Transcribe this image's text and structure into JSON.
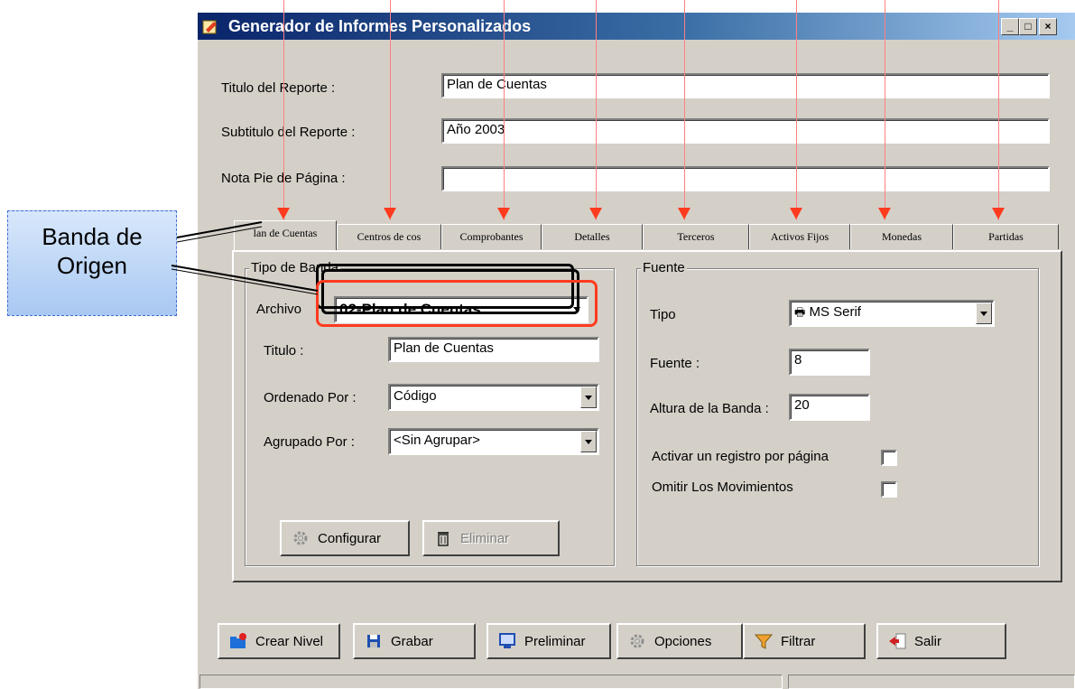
{
  "window": {
    "title": "Generador de Informes Personalizados"
  },
  "form": {
    "titulo_label": "Titulo del Reporte :",
    "titulo_value": "Plan de Cuentas",
    "subtitulo_label": "Subtitulo del Reporte :",
    "subtitulo_value": "Año 2003",
    "nota_label": "Nota Pie de Página :",
    "nota_value": ""
  },
  "tabs": [
    {
      "label": "lan de Cuentas"
    },
    {
      "label": "Centros de cos"
    },
    {
      "label": "Comprobantes"
    },
    {
      "label": "Detalles"
    },
    {
      "label": "Terceros"
    },
    {
      "label": "Activos Fijos"
    },
    {
      "label": "Monedas"
    },
    {
      "label": "Partidas"
    }
  ],
  "tipo_banda": {
    "group_label": "Tipo de Banda",
    "archivo_label": "Archivo",
    "archivo_value": "02-Plan de Cuentas",
    "titulo_label": "Titulo :",
    "titulo_value": "Plan de Cuentas",
    "ordenado_label": "Ordenado Por :",
    "ordenado_value": "Código",
    "agrupado_label": "Agrupado Por :",
    "agrupado_value": "<Sin Agrupar>",
    "configurar_label": "Configurar",
    "eliminar_label": "Eliminar"
  },
  "fuente": {
    "group_label": "Fuente",
    "tipo_label": "Tipo",
    "tipo_value": "MS Serif",
    "fuente_label": "Fuente :",
    "fuente_value": "8",
    "altura_label": "Altura de la Banda :",
    "altura_value": "20",
    "registro_label": "Activar un registro por página",
    "omitir_label": "Omitir Los Movimientos"
  },
  "buttons": {
    "crear": "Crear Nivel",
    "grabar": "Grabar",
    "preliminar": "Preliminar",
    "opciones": "Opciones",
    "filtrar": "Filtrar",
    "salir": "Salir"
  },
  "callout": {
    "line1": "Banda de",
    "line2": "Origen"
  },
  "colors": {
    "annotation_arrow": "#ff3b1f",
    "highlight_box": "#ff3b1f",
    "callout_fill": "#b9d4f6"
  }
}
